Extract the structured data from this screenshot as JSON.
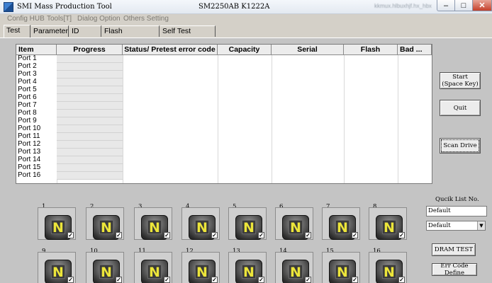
{
  "window": {
    "title": "SMI Mass Production Tool",
    "model": "SM2250AB  K1222A",
    "blurred_text": "kkmux.hlbuxhjf.hx_hbx"
  },
  "menu": [
    "Config HUB",
    "Tools[T]",
    "Dialog Option",
    "Others Setting"
  ],
  "tabs": [
    "Test",
    "Parameter",
    "ID Table",
    "Flash Diagnosis",
    "Self Test Result"
  ],
  "table": {
    "columns": [
      "Item",
      "Progress",
      "Status/ Pretest error code",
      "Capacity",
      "Serial",
      "Flash",
      "Bad ..."
    ],
    "rows": [
      "Port 1",
      "Port 2",
      "Port 3",
      "Port 4",
      "Port 5",
      "Port 6",
      "Port 7",
      "Port 8",
      "Port 9",
      "Port 10",
      "Port 11",
      "Port 12",
      "Port 13",
      "Port 14",
      "Port 15",
      "Port 16"
    ]
  },
  "buttons": {
    "start": "Start\n(Space Key)",
    "quit": "Quit",
    "scan": "Scan Drive",
    "dram": "DRAM TEST",
    "err": "Err Code Define"
  },
  "quick_list": {
    "label": "Qucik List No.",
    "value": "Default",
    "selected": "Default"
  },
  "ports": [
    {
      "num": "1",
      "letter": "N",
      "checked": true
    },
    {
      "num": "2",
      "letter": "N",
      "checked": true
    },
    {
      "num": "3",
      "letter": "N",
      "checked": true
    },
    {
      "num": "4",
      "letter": "N",
      "checked": true
    },
    {
      "num": "5",
      "letter": "N",
      "checked": true
    },
    {
      "num": "6",
      "letter": "N",
      "checked": true
    },
    {
      "num": "7",
      "letter": "N",
      "checked": true
    },
    {
      "num": "8",
      "letter": "N",
      "checked": true
    },
    {
      "num": "9",
      "letter": "N",
      "checked": true
    },
    {
      "num": "10",
      "letter": "N",
      "checked": true
    },
    {
      "num": "11",
      "letter": "N",
      "checked": true
    },
    {
      "num": "12",
      "letter": "N",
      "checked": true
    },
    {
      "num": "13",
      "letter": "N",
      "checked": true
    },
    {
      "num": "14",
      "letter": "N",
      "checked": true
    },
    {
      "num": "15",
      "letter": "N",
      "checked": true
    },
    {
      "num": "16",
      "letter": "N",
      "checked": true
    }
  ]
}
